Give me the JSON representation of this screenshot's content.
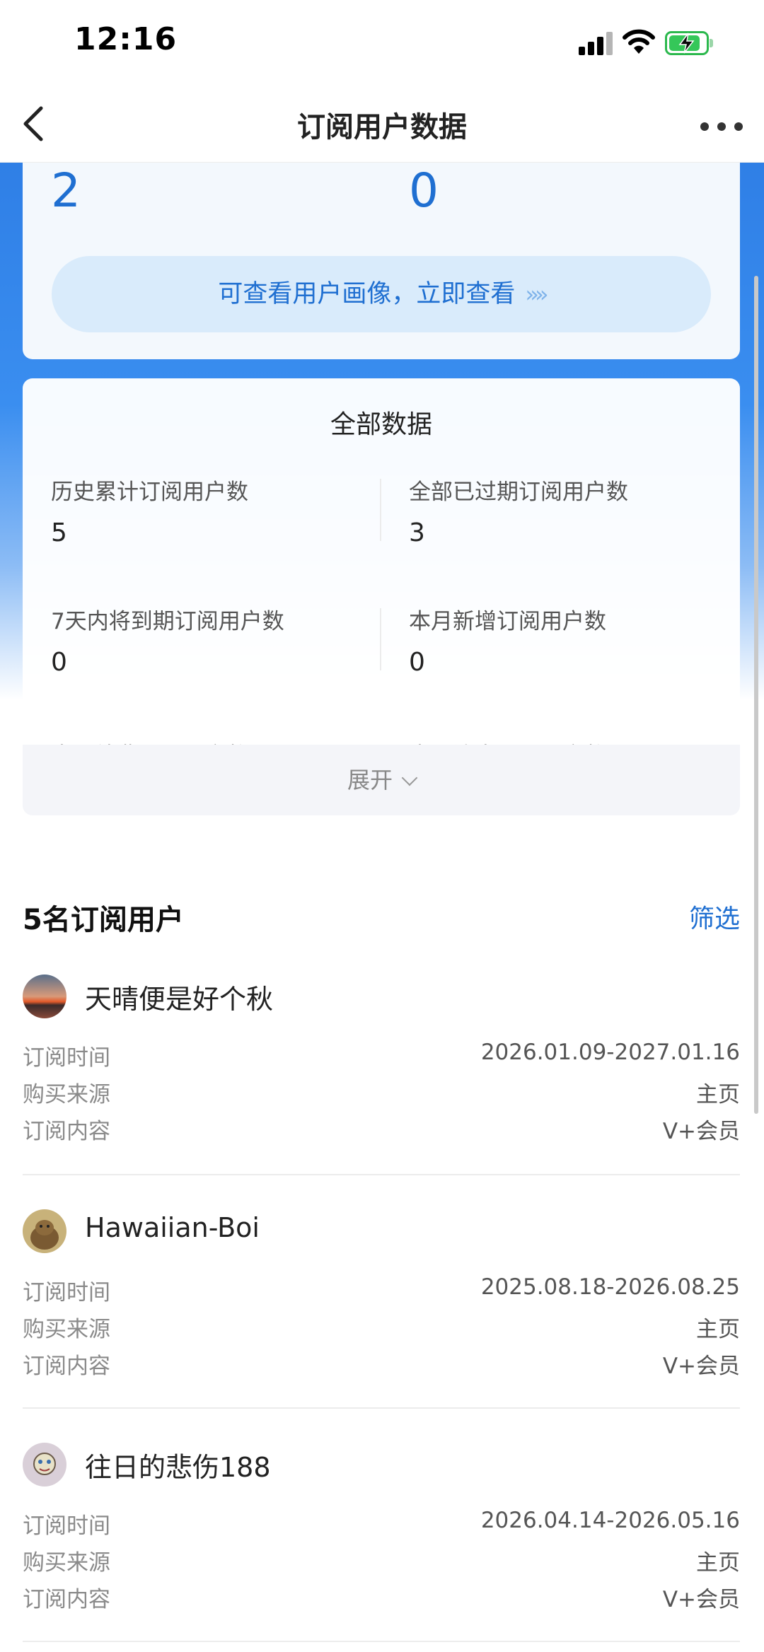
{
  "status_bar": {
    "time": "12:16"
  },
  "nav": {
    "title": "订阅用户数据"
  },
  "summary": {
    "left_value": "2",
    "right_value": "0",
    "portrait_button": "可查看用户画像，立即查看",
    "portrait_chevron": "»»"
  },
  "all_data": {
    "title": "全部数据",
    "stats": [
      {
        "label": "历史累计订阅用户数",
        "value": "5"
      },
      {
        "label": "全部已过期订阅用户数",
        "value": "3"
      },
      {
        "label": "7天内将到期订阅用户数",
        "value": "0"
      },
      {
        "label": "本月新增订阅用户数",
        "value": "0"
      }
    ],
    "cut_labels": [
      "本月续费订阅用户数",
      "本月流失订阅用户数"
    ],
    "expand_label": "展开"
  },
  "subscribers": {
    "title": "5名订阅用户",
    "filter_label": "筛选",
    "row_labels": {
      "time": "订阅时间",
      "source": "购买来源",
      "content": "订阅内容"
    },
    "users": [
      {
        "name": "天晴便是好个秋",
        "time": "2026.01.09-2027.01.16",
        "source": "主页",
        "content": "V+会员"
      },
      {
        "name": "Hawaiian-Boi",
        "time": "2025.08.18-2026.08.25",
        "source": "主页",
        "content": "V+会员"
      },
      {
        "name": "往日的悲伤188",
        "time": "2026.04.14-2026.05.16",
        "source": "主页",
        "content": "V+会员"
      }
    ]
  },
  "colors": {
    "accent": "#1f6fd1",
    "banner_blue": "#2f7fe6",
    "battery_green": "#35c759"
  },
  "battery_level": 0.85
}
